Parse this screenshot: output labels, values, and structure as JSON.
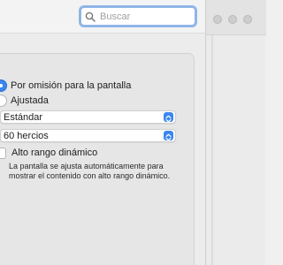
{
  "search": {
    "placeholder": "Buscar"
  },
  "resolution": {
    "options": [
      {
        "label": "Por omisión para la pantalla",
        "selected": true
      },
      {
        "label": "Ajustada",
        "selected": false
      }
    ]
  },
  "mode_popup": {
    "value": "Estándar"
  },
  "refresh_popup": {
    "value": "60 hercios"
  },
  "hdr": {
    "label": "Alto rango dinámico",
    "checked": false,
    "description": "La pantalla se ajusta automáticamente para mostrar el contenido con alto rango dinámico."
  },
  "colors": {
    "accent": "#3b86f0",
    "search_focus": "#8fb5e8"
  },
  "icons": {
    "search": "magnifying-glass",
    "popup": "chevron-up-down",
    "window_controls": "traffic-lights-inactive"
  }
}
